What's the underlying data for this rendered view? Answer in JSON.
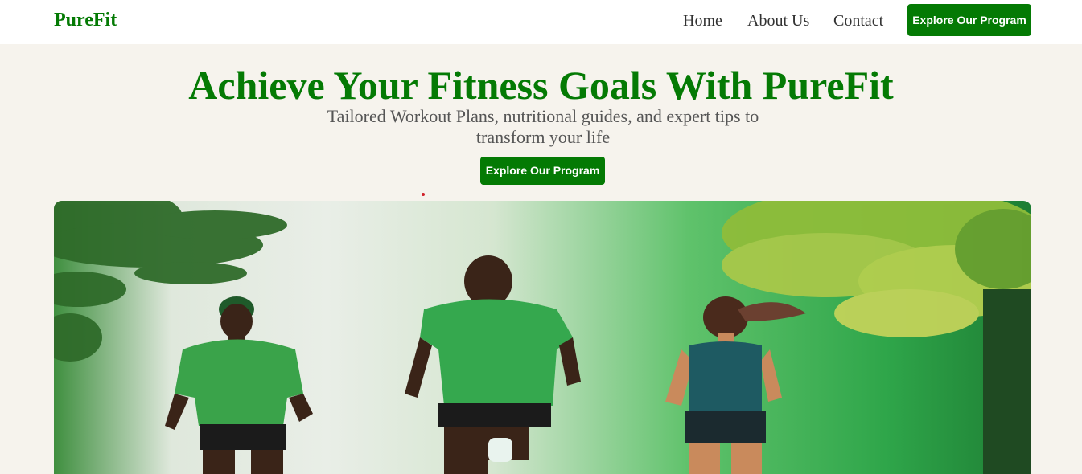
{
  "nav": {
    "brand": "PureFit",
    "links": [
      "Home",
      "About Us",
      "Contact"
    ],
    "cta_label": "Explore Our Program"
  },
  "hero": {
    "title": "Achieve Your Fitness Goals With PureFit",
    "subtitle": "Tailored Workout Plans, nutritional guides, and expert tips to transform your life",
    "cta_label": "Explore Our Program"
  },
  "colors": {
    "brand_green": "#047a04",
    "page_background": "#f6f3ed",
    "navbar_background": "#ffffff"
  }
}
